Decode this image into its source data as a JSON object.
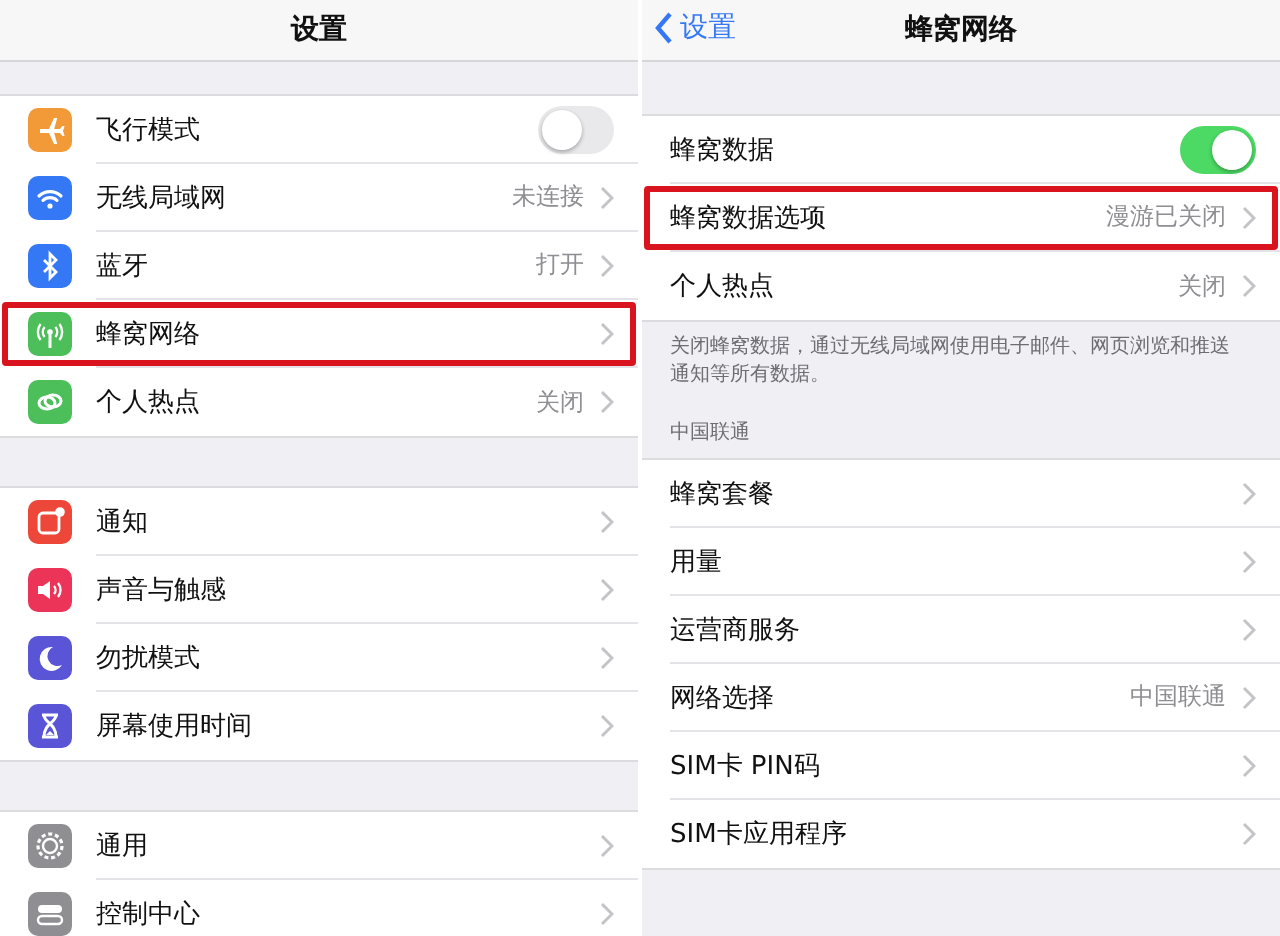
{
  "left": {
    "title": "设置",
    "groups": [
      {
        "rows": [
          {
            "label": "飞行模式",
            "kind": "toggle",
            "on": false,
            "highlighted": false
          },
          {
            "label": "无线局域网",
            "kind": "link",
            "value": "未连接",
            "highlighted": false
          },
          {
            "label": "蓝牙",
            "kind": "link",
            "value": "打开",
            "highlighted": false
          },
          {
            "label": "蜂窝网络",
            "kind": "link",
            "highlighted": true
          },
          {
            "label": "个人热点",
            "kind": "link",
            "value": "关闭",
            "highlighted": false
          }
        ]
      },
      {
        "rows": [
          {
            "label": "通知",
            "kind": "link",
            "highlighted": false
          },
          {
            "label": "声音与触感",
            "kind": "link",
            "highlighted": false
          },
          {
            "label": "勿扰模式",
            "kind": "link",
            "highlighted": false
          },
          {
            "label": "屏幕使用时间",
            "kind": "link",
            "highlighted": false
          }
        ]
      },
      {
        "rows": [
          {
            "label": "通用",
            "kind": "link",
            "highlighted": false
          },
          {
            "label": "控制中心",
            "kind": "link",
            "highlighted": false
          }
        ]
      }
    ]
  },
  "right": {
    "back": "设置",
    "title": "蜂窝网络",
    "groups": [
      {
        "rows": [
          {
            "label": "蜂窝数据",
            "kind": "toggle",
            "on": true,
            "highlighted": false
          },
          {
            "label": "蜂窝数据选项",
            "kind": "link",
            "value": "漫游已关闭",
            "highlighted": true
          },
          {
            "label": "个人热点",
            "kind": "link",
            "value": "关闭",
            "highlighted": false
          }
        ],
        "footer": "关闭蜂窝数据，通过无线局域网使用电子邮件、网页浏览和推送通知等所有数据。"
      },
      {
        "header": "中国联通",
        "rows": [
          {
            "label": "蜂窝套餐",
            "kind": "link",
            "highlighted": false
          },
          {
            "label": "用量",
            "kind": "link",
            "highlighted": false
          },
          {
            "label": "运营商服务",
            "kind": "link",
            "highlighted": false
          },
          {
            "label": "网络选择",
            "kind": "link",
            "value": "中国联通",
            "highlighted": false
          },
          {
            "label": "SIM卡 PIN码",
            "kind": "link",
            "highlighted": false
          },
          {
            "label": "SIM卡应用程序",
            "kind": "link",
            "highlighted": false
          }
        ]
      }
    ]
  }
}
